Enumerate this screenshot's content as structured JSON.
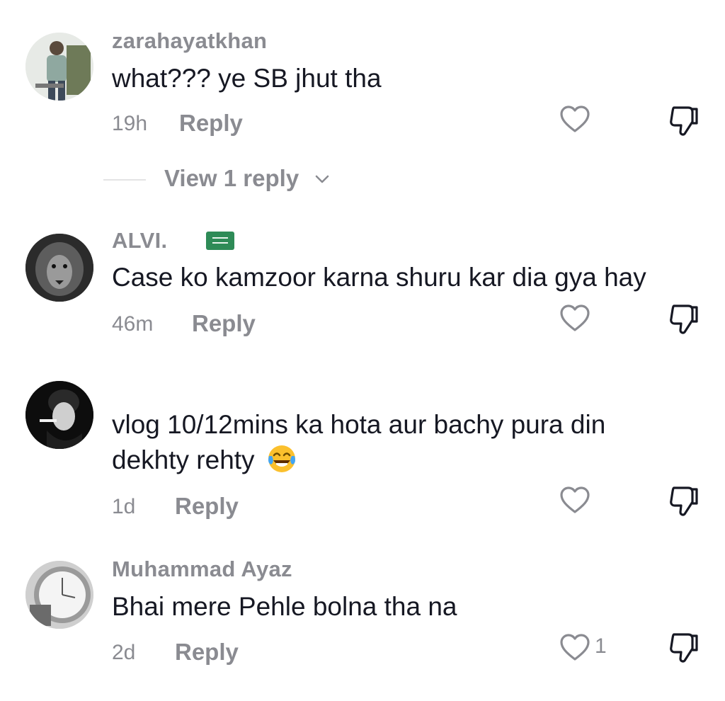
{
  "comments": [
    {
      "username": "zarahayatkhan",
      "text": "what??? ye SB jhut tha",
      "time": "19h",
      "reply_label": "Reply",
      "avatar_icon": "person-photo-avatar",
      "view_replies_label": "View 1 reply"
    },
    {
      "username": "ALVI.",
      "flag_icon": "saudi-arabia-flag-icon",
      "text": "Case ko kamzoor karna shuru kar dia gya hay",
      "time": "46m",
      "reply_label": "Reply",
      "avatar_icon": "lion-photo-avatar"
    },
    {
      "username": "",
      "text_line1": "vlog 10/12mins ka hota aur bachy pura din",
      "text_line2": "dekhty rehty",
      "emoji": "face-with-tears-of-joy",
      "time": "1d",
      "reply_label": "Reply",
      "avatar_icon": "smoking-man-photo-avatar"
    },
    {
      "username": "Muhammad Ayaz",
      "text": "Bhai mere Pehle bolna tha na",
      "time": "2d",
      "reply_label": "Reply",
      "like_count": "1",
      "avatar_icon": "watch-photo-avatar"
    }
  ],
  "colors": {
    "text": "#161823",
    "muted": "#8a8b91",
    "icon": "#8a8b91",
    "flag": "#2e8b57"
  }
}
